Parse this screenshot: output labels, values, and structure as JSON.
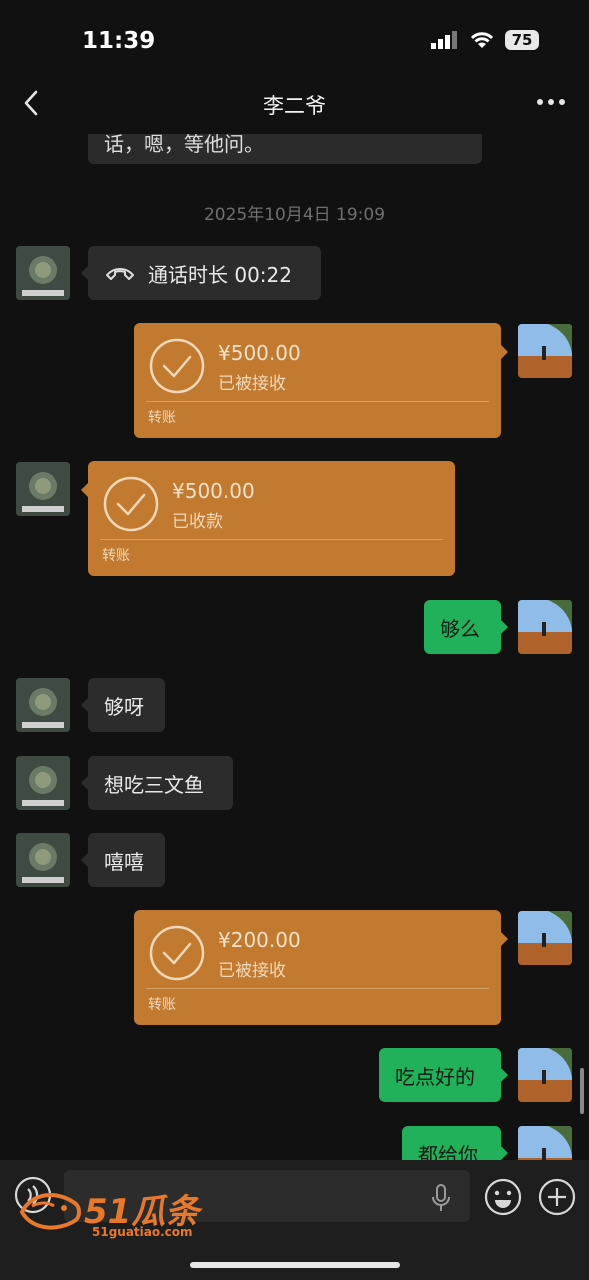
{
  "status_bar": {
    "time": "11:39",
    "battery": "75"
  },
  "header": {
    "title": "李二爷"
  },
  "chat": {
    "partial_message": "话，嗯，等他问。",
    "timestamp": "2025年10月4日 19:09",
    "call": {
      "text": "通话时长 00:22"
    },
    "transfer_1": {
      "amount": "¥500.00",
      "status": "已被接收",
      "label": "转账"
    },
    "transfer_2": {
      "amount": "¥500.00",
      "status": "已收款",
      "label": "转账"
    },
    "msg_gou_me": "够么",
    "msg_gouya": "够呀",
    "msg_salmon": "想吃三文鱼",
    "msg_xixi": "嘻嘻",
    "transfer_3": {
      "amount": "¥200.00",
      "status": "已被接收",
      "label": "转账"
    },
    "msg_eat_good": "吃点好的",
    "msg_all_for_you": "都给你"
  },
  "watermark": {
    "text": "51瓜条",
    "sub": "51guatiao.com"
  },
  "colors": {
    "background": "#111111",
    "transfer": "#c17a2f",
    "sent_bubble": "#21b15a",
    "received_bubble": "#2c2c2c"
  }
}
